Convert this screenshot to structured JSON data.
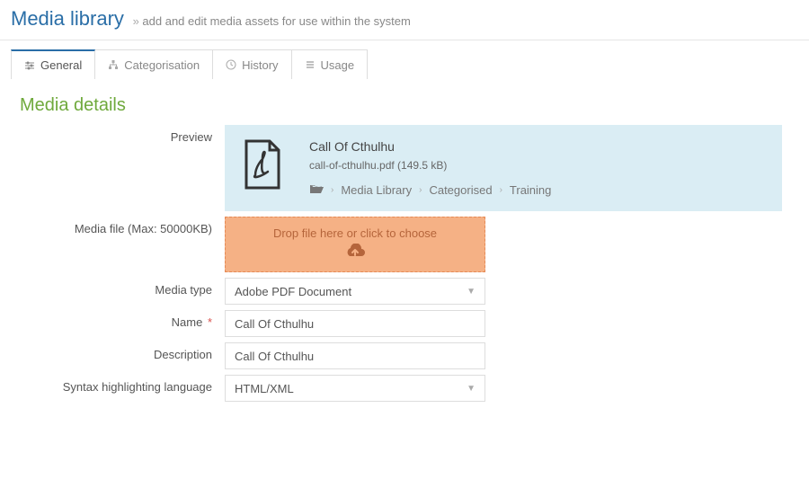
{
  "header": {
    "title": "Media library",
    "subtitle": "add and edit media assets for use within the system"
  },
  "tabs": [
    {
      "label": "General"
    },
    {
      "label": "Categorisation"
    },
    {
      "label": "History"
    },
    {
      "label": "Usage"
    }
  ],
  "section": {
    "title": "Media details"
  },
  "labels": {
    "preview": "Preview",
    "media_file": "Media file (Max: 50000KB)",
    "media_type": "Media type",
    "name": "Name",
    "description": "Description",
    "syntax": "Syntax highlighting language"
  },
  "preview": {
    "title": "Call Of Cthulhu",
    "filename": "call-of-cthulhu.pdf (149.5 kB)",
    "crumbs": [
      "Media Library",
      "Categorised",
      "Training"
    ]
  },
  "dropzone": {
    "label": "Drop file here or click to choose"
  },
  "fields": {
    "media_type": "Adobe PDF Document",
    "name": "Call Of Cthulhu",
    "description": "Call Of Cthulhu",
    "syntax": "HTML/XML"
  }
}
